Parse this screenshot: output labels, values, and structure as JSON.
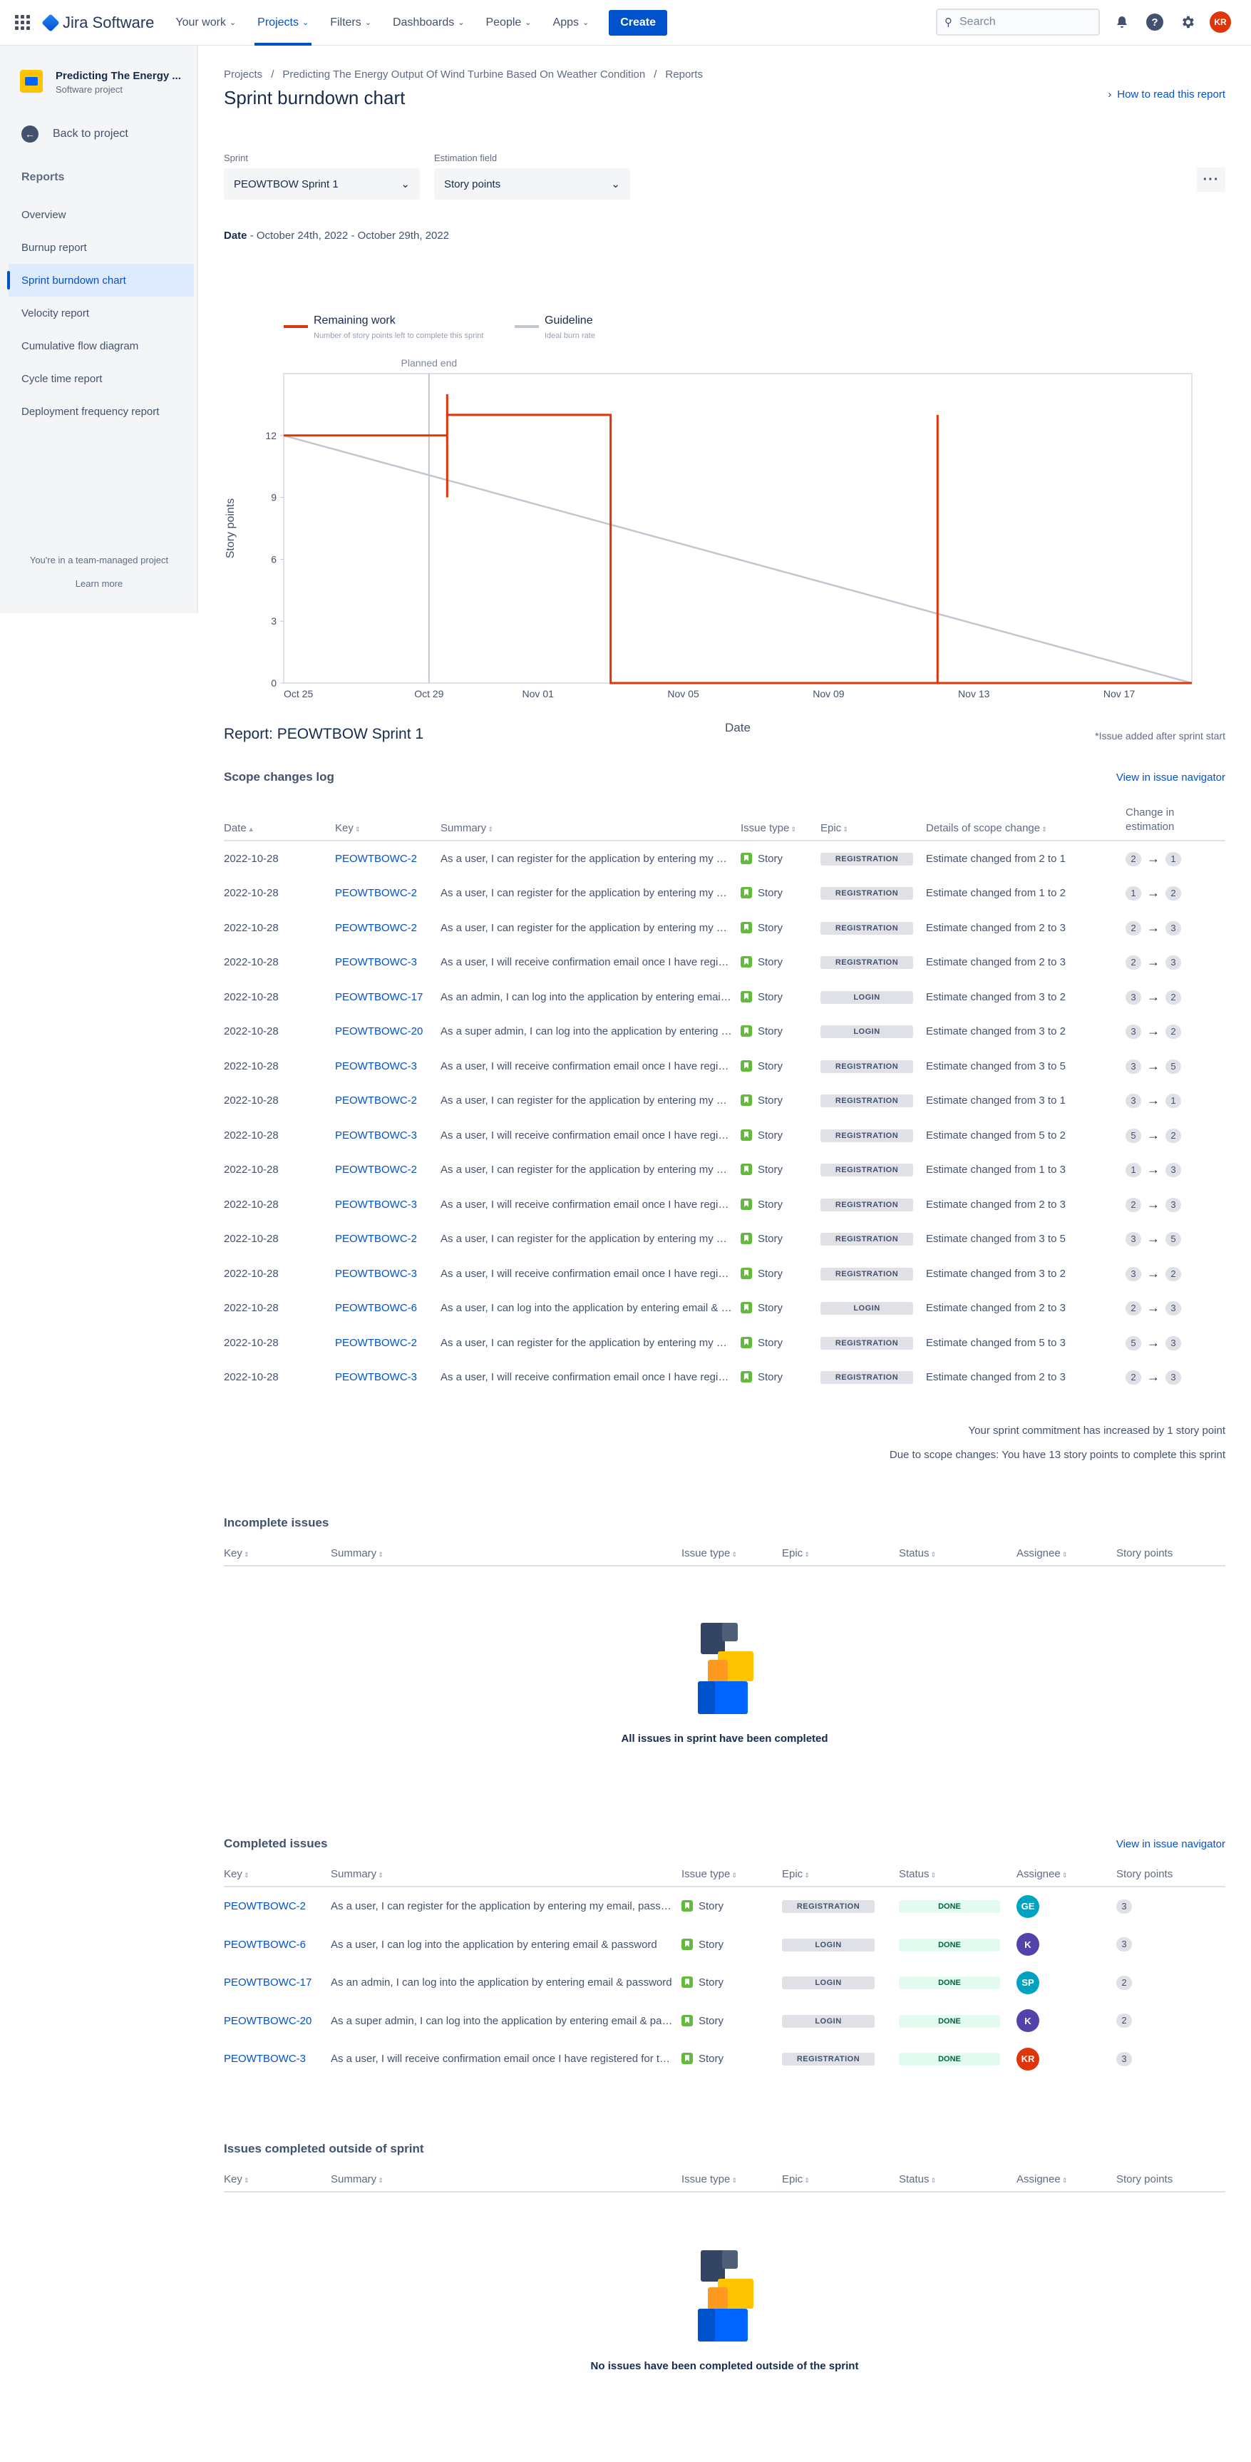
{
  "topnav": {
    "app_name": "Jira Software",
    "items": [
      {
        "label": "Your work"
      },
      {
        "label": "Projects"
      },
      {
        "label": "Filters"
      },
      {
        "label": "Dashboards"
      },
      {
        "label": "People"
      },
      {
        "label": "Apps"
      }
    ],
    "create_label": "Create",
    "search_placeholder": "Search",
    "avatar_initials": "KR",
    "icons": [
      "app-switcher-icon",
      "notification-icon",
      "help-icon",
      "settings-icon",
      "search-icon"
    ]
  },
  "sidebar": {
    "project_name": "Predicting The Energy ...",
    "project_type": "Software project",
    "back_label": "Back to project",
    "section_title": "Reports",
    "items": [
      {
        "label": "Overview"
      },
      {
        "label": "Burnup report"
      },
      {
        "label": "Sprint burndown chart"
      },
      {
        "label": "Velocity report"
      },
      {
        "label": "Cumulative flow diagram"
      },
      {
        "label": "Cycle time report"
      },
      {
        "label": "Deployment frequency report"
      }
    ],
    "team_note": "You're in a team-managed project",
    "learn_more": "Learn more"
  },
  "breadcrumb": {
    "items": [
      "Projects",
      "Predicting The Energy Output Of Wind Turbine Based On Weather Condition",
      "Reports"
    ]
  },
  "page": {
    "title": "Sprint burndown chart",
    "how_to": "How to read this report",
    "sprint_label": "Sprint",
    "sprint_value": "PEOWTBOW Sprint 1",
    "estimation_label": "Estimation field",
    "estimation_value": "Story points",
    "date_label": "Date",
    "date_range": "- October 24th, 2022 - October 29th, 2022"
  },
  "chart_data": {
    "type": "line",
    "xlabel": "Date",
    "ylabel": "Story points",
    "x_ticks": [
      "Oct 25",
      "Oct 29",
      "Nov 01",
      "Nov 05",
      "Nov 09",
      "Nov 13",
      "Nov 17"
    ],
    "y_ticks": [
      0,
      3,
      6,
      9,
      12
    ],
    "ylim": [
      0,
      15
    ],
    "xlim": [
      "2022-10-25",
      "2022-11-19"
    ],
    "planned_end_label": "Planned end",
    "planned_end_date": "2022-10-29",
    "legend": [
      {
        "name": "Remaining work",
        "desc": "Number of story points left to complete this sprint",
        "color": "#de350b"
      },
      {
        "name": "Guideline",
        "desc": "Ideal burn rate",
        "color": "#c1c7d0"
      }
    ],
    "series": [
      {
        "name": "Remaining work",
        "points": [
          {
            "x": "2022-10-25",
            "y": 12
          },
          {
            "x": "2022-10-29.5",
            "y": 12
          },
          {
            "x": "2022-10-29.5",
            "y": 14
          },
          {
            "x": "2022-10-29.5",
            "y": 9
          },
          {
            "x": "2022-10-29.5",
            "y": 13
          },
          {
            "x": "2022-11-03",
            "y": 13
          },
          {
            "x": "2022-11-03",
            "y": 0
          },
          {
            "x": "2022-11-12",
            "y": 0
          },
          {
            "x": "2022-11-12",
            "y": 13
          },
          {
            "x": "2022-11-12",
            "y": 0
          },
          {
            "x": "2022-11-19",
            "y": 0
          }
        ]
      },
      {
        "name": "Guideline",
        "points": [
          {
            "x": "2022-10-25",
            "y": 12
          },
          {
            "x": "2022-11-19",
            "y": 0
          }
        ]
      }
    ]
  },
  "report": {
    "title": "Report: PEOWTBOW Sprint 1",
    "issue_added_note": "*Issue added after sprint start",
    "scope_title": "Scope changes log",
    "view_navigator": "View in issue navigator",
    "scope_headers": [
      "Date",
      "Key",
      "Summary",
      "Issue type",
      "Epic",
      "Details of scope change",
      "Change in estimation"
    ],
    "scope_rows": [
      {
        "date": "2022-10-28",
        "key": "PEOWTBOWC-2",
        "summary": "As a user, I can register for the application by entering my email, password, and confirming my password.",
        "type": "Story",
        "epic": "REGISTRATION",
        "detail": "Estimate changed from 2 to 1",
        "from": "2",
        "to": "1"
      },
      {
        "date": "2022-10-28",
        "key": "PEOWTBOWC-2",
        "summary": "As a user, I can register for the application by entering my email, password, and confirming my password.",
        "type": "Story",
        "epic": "REGISTRATION",
        "detail": "Estimate changed from 1 to 2",
        "from": "1",
        "to": "2"
      },
      {
        "date": "2022-10-28",
        "key": "PEOWTBOWC-2",
        "summary": "As a user, I can register for the application by entering my email, password, and confirming my password.",
        "type": "Story",
        "epic": "REGISTRATION",
        "detail": "Estimate changed from 2 to 3",
        "from": "2",
        "to": "3"
      },
      {
        "date": "2022-10-28",
        "key": "PEOWTBOWC-3",
        "summary": "As a user, I will receive confirmation email once I have registered for the application",
        "type": "Story",
        "epic": "REGISTRATION",
        "detail": "Estimate changed from 2 to 3",
        "from": "2",
        "to": "3"
      },
      {
        "date": "2022-10-28",
        "key": "PEOWTBOWC-17",
        "summary": "As an admin, I can log into the application by entering email & password",
        "type": "Story",
        "epic": "LOGIN",
        "detail": "Estimate changed from 3 to 2",
        "from": "3",
        "to": "2"
      },
      {
        "date": "2022-10-28",
        "key": "PEOWTBOWC-20",
        "summary": "As a super admin, I can log into the application by entering email & password",
        "type": "Story",
        "epic": "LOGIN",
        "detail": "Estimate changed from 3 to 2",
        "from": "3",
        "to": "2"
      },
      {
        "date": "2022-10-28",
        "key": "PEOWTBOWC-3",
        "summary": "As a user, I will receive confirmation email once I have registered for the application",
        "type": "Story",
        "epic": "REGISTRATION",
        "detail": "Estimate changed from 3 to 5",
        "from": "3",
        "to": "5"
      },
      {
        "date": "2022-10-28",
        "key": "PEOWTBOWC-2",
        "summary": "As a user, I can register for the application by entering my email, password, and confirming my password.",
        "type": "Story",
        "epic": "REGISTRATION",
        "detail": "Estimate changed from 3 to 1",
        "from": "3",
        "to": "1"
      },
      {
        "date": "2022-10-28",
        "key": "PEOWTBOWC-3",
        "summary": "As a user, I will receive confirmation email once I have registered for the application",
        "type": "Story",
        "epic": "REGISTRATION",
        "detail": "Estimate changed from 5 to 2",
        "from": "5",
        "to": "2"
      },
      {
        "date": "2022-10-28",
        "key": "PEOWTBOWC-2",
        "summary": "As a user, I can register for the application by entering my email, password, and confirming my password.",
        "type": "Story",
        "epic": "REGISTRATION",
        "detail": "Estimate changed from 1 to 3",
        "from": "1",
        "to": "3"
      },
      {
        "date": "2022-10-28",
        "key": "PEOWTBOWC-3",
        "summary": "As a user, I will receive confirmation email once I have registered for the application",
        "type": "Story",
        "epic": "REGISTRATION",
        "detail": "Estimate changed from 2 to 3",
        "from": "2",
        "to": "3"
      },
      {
        "date": "2022-10-28",
        "key": "PEOWTBOWC-2",
        "summary": "As a user, I can register for the application by entering my email, password, and confirming my password.",
        "type": "Story",
        "epic": "REGISTRATION",
        "detail": "Estimate changed from 3 to 5",
        "from": "3",
        "to": "5"
      },
      {
        "date": "2022-10-28",
        "key": "PEOWTBOWC-3",
        "summary": "As a user, I will receive confirmation email once I have registered for the application",
        "type": "Story",
        "epic": "REGISTRATION",
        "detail": "Estimate changed from 3 to 2",
        "from": "3",
        "to": "2"
      },
      {
        "date": "2022-10-28",
        "key": "PEOWTBOWC-6",
        "summary": "As a user, I can log into the application by entering email & password",
        "type": "Story",
        "epic": "LOGIN",
        "detail": "Estimate changed from 2 to 3",
        "from": "2",
        "to": "3"
      },
      {
        "date": "2022-10-28",
        "key": "PEOWTBOWC-2",
        "summary": "As a user, I can register for the application by entering my email, password, and confirming my password.",
        "type": "Story",
        "epic": "REGISTRATION",
        "detail": "Estimate changed from 5 to 3",
        "from": "5",
        "to": "3"
      },
      {
        "date": "2022-10-28",
        "key": "PEOWTBOWC-3",
        "summary": "As a user, I will receive confirmation email once I have registered for the application",
        "type": "Story",
        "epic": "REGISTRATION",
        "detail": "Estimate changed from 2 to 3",
        "from": "2",
        "to": "3"
      }
    ],
    "commitment_note": "Your sprint commitment has increased by 1 story point",
    "scope_note": "Due to scope changes: You have 13 story points to complete this sprint"
  },
  "incomplete": {
    "title": "Incomplete issues",
    "headers": [
      "Key",
      "Summary",
      "Issue type",
      "Epic",
      "Status",
      "Assignee",
      "Story points"
    ],
    "empty_message": "All issues in sprint have been completed"
  },
  "completed": {
    "title": "Completed issues",
    "view_navigator": "View in issue navigator",
    "headers": [
      "Key",
      "Summary",
      "Issue type",
      "Epic",
      "Status",
      "Assignee",
      "Story points"
    ],
    "rows": [
      {
        "key": "PEOWTBOWC-2",
        "summary": "As a user, I can register for the application by entering my email, password, and confirming my password.",
        "type": "Story",
        "epic": "REGISTRATION",
        "status": "DONE",
        "assignee": "GE",
        "assignee_color": "#00a3bf",
        "points": "3"
      },
      {
        "key": "PEOWTBOWC-6",
        "summary": "As a user, I can log into the application by entering email & password",
        "type": "Story",
        "epic": "LOGIN",
        "status": "DONE",
        "assignee": "K",
        "assignee_color": "#5243aa",
        "points": "3"
      },
      {
        "key": "PEOWTBOWC-17",
        "summary": "As an admin, I can log into the application by entering email & password",
        "type": "Story",
        "epic": "LOGIN",
        "status": "DONE",
        "assignee": "SP",
        "assignee_color": "#00a3bf",
        "points": "2"
      },
      {
        "key": "PEOWTBOWC-20",
        "summary": "As a super admin, I can log into the application by entering email & password",
        "type": "Story",
        "epic": "LOGIN",
        "status": "DONE",
        "assignee": "K",
        "assignee_color": "#5243aa",
        "points": "2"
      },
      {
        "key": "PEOWTBOWC-3",
        "summary": "As a user, I will receive confirmation email once I have registered for the application",
        "type": "Story",
        "epic": "REGISTRATION",
        "status": "DONE",
        "assignee": "KR",
        "assignee_color": "#de350b",
        "points": "3"
      }
    ]
  },
  "outside": {
    "title": "Issues completed outside of sprint",
    "headers": [
      "Key",
      "Summary",
      "Issue type",
      "Epic",
      "Status",
      "Assignee",
      "Story points"
    ],
    "empty_message": "No issues have been completed outside of the sprint"
  }
}
